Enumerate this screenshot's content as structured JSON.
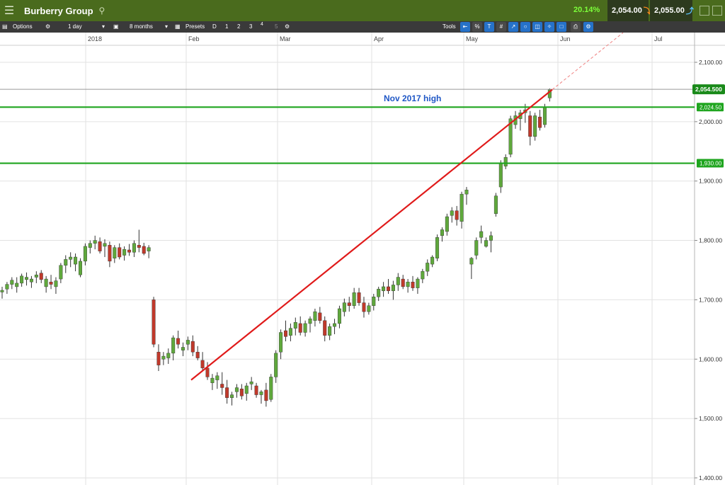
{
  "header": {
    "instrument": "Burberry Group",
    "change_pct": "20.14%",
    "sell_price": "2,054.00",
    "buy_price": "2,055.00"
  },
  "toolbar": {
    "options_label": "Options",
    "interval": "1 day",
    "range": "8 months",
    "presets_label": "Presets",
    "presets": [
      "D",
      "1",
      "2",
      "3",
      "4",
      "5"
    ],
    "tools_label": "Tools"
  },
  "colors": {
    "up": "#5fa83c",
    "down": "#c0392b",
    "trendline": "#e01a1a",
    "level": "#1fa51f",
    "label_blue": "#1f57c6"
  },
  "chart_data": {
    "type": "candlestick",
    "title": "",
    "x_tick_labels": [
      "2018",
      "Feb",
      "Mar",
      "Apr",
      "May",
      "Jun",
      "Jul"
    ],
    "y_tick_labels": [
      "2,100.00",
      "2,000.00",
      "1,900.00",
      "1,800.00",
      "1,700.00",
      "1,600.00",
      "1,500.00",
      "1,400.00"
    ],
    "ylim": [
      1380,
      2140
    ],
    "grid": true,
    "price_axis_side": "right",
    "annotations": [
      {
        "type": "text",
        "text": "Nov 2017 high"
      },
      {
        "type": "hline",
        "value": 2024.5,
        "label": "2,024.50",
        "color": "#1fa51f"
      },
      {
        "type": "hline",
        "value": 1930.0,
        "label": "1,930.00",
        "color": "#1fa51f"
      },
      {
        "type": "last_price",
        "value": 2054.5,
        "label": "2,054.500"
      },
      {
        "type": "trendline",
        "from": [
          1565,
          "Feb 1"
        ],
        "to": [
          2054,
          "May 31"
        ],
        "extended": true
      }
    ],
    "candles": [
      {
        "o": 1713,
        "h": 1722,
        "l": 1702,
        "c": 1716
      },
      {
        "o": 1718,
        "h": 1730,
        "l": 1710,
        "c": 1726
      },
      {
        "o": 1726,
        "h": 1738,
        "l": 1718,
        "c": 1733
      },
      {
        "o": 1722,
        "h": 1738,
        "l": 1712,
        "c": 1728
      },
      {
        "o": 1728,
        "h": 1744,
        "l": 1722,
        "c": 1740
      },
      {
        "o": 1734,
        "h": 1746,
        "l": 1724,
        "c": 1738
      },
      {
        "o": 1730,
        "h": 1740,
        "l": 1720,
        "c": 1735
      },
      {
        "o": 1738,
        "h": 1748,
        "l": 1728,
        "c": 1742
      },
      {
        "o": 1745,
        "h": 1750,
        "l": 1728,
        "c": 1734
      },
      {
        "o": 1722,
        "h": 1740,
        "l": 1712,
        "c": 1735
      },
      {
        "o": 1730,
        "h": 1742,
        "l": 1718,
        "c": 1726
      },
      {
        "o": 1722,
        "h": 1738,
        "l": 1710,
        "c": 1732
      },
      {
        "o": 1735,
        "h": 1762,
        "l": 1728,
        "c": 1758
      },
      {
        "o": 1758,
        "h": 1775,
        "l": 1745,
        "c": 1768
      },
      {
        "o": 1768,
        "h": 1780,
        "l": 1755,
        "c": 1772
      },
      {
        "o": 1760,
        "h": 1778,
        "l": 1748,
        "c": 1772
      },
      {
        "o": 1742,
        "h": 1770,
        "l": 1738,
        "c": 1765
      },
      {
        "o": 1765,
        "h": 1795,
        "l": 1758,
        "c": 1790
      },
      {
        "o": 1788,
        "h": 1800,
        "l": 1778,
        "c": 1795
      },
      {
        "o": 1795,
        "h": 1808,
        "l": 1785,
        "c": 1800
      },
      {
        "o": 1798,
        "h": 1805,
        "l": 1778,
        "c": 1782
      },
      {
        "o": 1790,
        "h": 1802,
        "l": 1772,
        "c": 1795
      },
      {
        "o": 1792,
        "h": 1798,
        "l": 1755,
        "c": 1765
      },
      {
        "o": 1770,
        "h": 1792,
        "l": 1762,
        "c": 1788
      },
      {
        "o": 1788,
        "h": 1795,
        "l": 1768,
        "c": 1772
      },
      {
        "o": 1775,
        "h": 1790,
        "l": 1766,
        "c": 1785
      },
      {
        "o": 1784,
        "h": 1794,
        "l": 1774,
        "c": 1780
      },
      {
        "o": 1780,
        "h": 1800,
        "l": 1772,
        "c": 1795
      },
      {
        "o": 1792,
        "h": 1818,
        "l": 1780,
        "c": 1788
      },
      {
        "o": 1790,
        "h": 1796,
        "l": 1775,
        "c": 1778
      },
      {
        "o": 1782,
        "h": 1792,
        "l": 1770,
        "c": 1788
      },
      {
        "o": 1700,
        "h": 1705,
        "l": 1620,
        "c": 1625
      },
      {
        "o": 1612,
        "h": 1625,
        "l": 1580,
        "c": 1590
      },
      {
        "o": 1600,
        "h": 1612,
        "l": 1590,
        "c": 1605
      },
      {
        "o": 1602,
        "h": 1618,
        "l": 1592,
        "c": 1610
      },
      {
        "o": 1610,
        "h": 1640,
        "l": 1598,
        "c": 1636
      },
      {
        "o": 1635,
        "h": 1648,
        "l": 1618,
        "c": 1625
      },
      {
        "o": 1615,
        "h": 1628,
        "l": 1605,
        "c": 1620
      },
      {
        "o": 1625,
        "h": 1638,
        "l": 1615,
        "c": 1632
      },
      {
        "o": 1630,
        "h": 1640,
        "l": 1605,
        "c": 1612
      },
      {
        "o": 1612,
        "h": 1622,
        "l": 1598,
        "c": 1602
      },
      {
        "o": 1598,
        "h": 1612,
        "l": 1580,
        "c": 1585
      },
      {
        "o": 1585,
        "h": 1595,
        "l": 1565,
        "c": 1570
      },
      {
        "o": 1560,
        "h": 1575,
        "l": 1548,
        "c": 1568
      },
      {
        "o": 1565,
        "h": 1578,
        "l": 1550,
        "c": 1572
      },
      {
        "o": 1558,
        "h": 1578,
        "l": 1540,
        "c": 1552
      },
      {
        "o": 1552,
        "h": 1565,
        "l": 1525,
        "c": 1535
      },
      {
        "o": 1535,
        "h": 1545,
        "l": 1522,
        "c": 1540
      },
      {
        "o": 1545,
        "h": 1558,
        "l": 1535,
        "c": 1552
      },
      {
        "o": 1550,
        "h": 1558,
        "l": 1532,
        "c": 1538
      },
      {
        "o": 1542,
        "h": 1560,
        "l": 1530,
        "c": 1555
      },
      {
        "o": 1558,
        "h": 1570,
        "l": 1548,
        "c": 1562
      },
      {
        "o": 1555,
        "h": 1560,
        "l": 1535,
        "c": 1540
      },
      {
        "o": 1540,
        "h": 1548,
        "l": 1525,
        "c": 1545
      },
      {
        "o": 1548,
        "h": 1560,
        "l": 1520,
        "c": 1530
      },
      {
        "o": 1532,
        "h": 1575,
        "l": 1528,
        "c": 1570
      },
      {
        "o": 1570,
        "h": 1615,
        "l": 1560,
        "c": 1610
      },
      {
        "o": 1612,
        "h": 1650,
        "l": 1600,
        "c": 1645
      },
      {
        "o": 1648,
        "h": 1665,
        "l": 1630,
        "c": 1638
      },
      {
        "o": 1640,
        "h": 1660,
        "l": 1630,
        "c": 1652
      },
      {
        "o": 1652,
        "h": 1670,
        "l": 1640,
        "c": 1662
      },
      {
        "o": 1660,
        "h": 1672,
        "l": 1640,
        "c": 1645
      },
      {
        "o": 1645,
        "h": 1665,
        "l": 1638,
        "c": 1660
      },
      {
        "o": 1660,
        "h": 1672,
        "l": 1645,
        "c": 1668
      },
      {
        "o": 1665,
        "h": 1685,
        "l": 1655,
        "c": 1680
      },
      {
        "o": 1678,
        "h": 1688,
        "l": 1660,
        "c": 1665
      },
      {
        "o": 1665,
        "h": 1672,
        "l": 1630,
        "c": 1640
      },
      {
        "o": 1640,
        "h": 1660,
        "l": 1632,
        "c": 1655
      },
      {
        "o": 1655,
        "h": 1668,
        "l": 1642,
        "c": 1660
      },
      {
        "o": 1660,
        "h": 1690,
        "l": 1652,
        "c": 1685
      },
      {
        "o": 1680,
        "h": 1702,
        "l": 1672,
        "c": 1695
      },
      {
        "o": 1695,
        "h": 1705,
        "l": 1680,
        "c": 1690
      },
      {
        "o": 1690,
        "h": 1720,
        "l": 1685,
        "c": 1712
      },
      {
        "o": 1712,
        "h": 1720,
        "l": 1690,
        "c": 1695
      },
      {
        "o": 1695,
        "h": 1705,
        "l": 1670,
        "c": 1680
      },
      {
        "o": 1680,
        "h": 1695,
        "l": 1675,
        "c": 1690
      },
      {
        "o": 1690,
        "h": 1710,
        "l": 1682,
        "c": 1705
      },
      {
        "o": 1705,
        "h": 1722,
        "l": 1698,
        "c": 1718
      },
      {
        "o": 1715,
        "h": 1730,
        "l": 1705,
        "c": 1722
      },
      {
        "o": 1722,
        "h": 1735,
        "l": 1710,
        "c": 1715
      },
      {
        "o": 1715,
        "h": 1732,
        "l": 1700,
        "c": 1725
      },
      {
        "o": 1725,
        "h": 1745,
        "l": 1715,
        "c": 1738
      },
      {
        "o": 1735,
        "h": 1742,
        "l": 1718,
        "c": 1722
      },
      {
        "o": 1722,
        "h": 1735,
        "l": 1712,
        "c": 1730
      },
      {
        "o": 1730,
        "h": 1740,
        "l": 1715,
        "c": 1720
      },
      {
        "o": 1720,
        "h": 1738,
        "l": 1710,
        "c": 1735
      },
      {
        "o": 1735,
        "h": 1752,
        "l": 1728,
        "c": 1748
      },
      {
        "o": 1748,
        "h": 1768,
        "l": 1740,
        "c": 1762
      },
      {
        "o": 1760,
        "h": 1775,
        "l": 1755,
        "c": 1772
      },
      {
        "o": 1770,
        "h": 1810,
        "l": 1765,
        "c": 1805
      },
      {
        "o": 1808,
        "h": 1822,
        "l": 1798,
        "c": 1818
      },
      {
        "o": 1815,
        "h": 1845,
        "l": 1808,
        "c": 1840
      },
      {
        "o": 1842,
        "h": 1856,
        "l": 1830,
        "c": 1850
      },
      {
        "o": 1850,
        "h": 1858,
        "l": 1825,
        "c": 1835
      },
      {
        "o": 1832,
        "h": 1882,
        "l": 1820,
        "c": 1878
      },
      {
        "o": 1878,
        "h": 1890,
        "l": 1860,
        "c": 1885
      },
      {
        "o": 1760,
        "h": 1772,
        "l": 1735,
        "c": 1770
      },
      {
        "o": 1775,
        "h": 1805,
        "l": 1768,
        "c": 1800
      },
      {
        "o": 1805,
        "h": 1825,
        "l": 1795,
        "c": 1815
      },
      {
        "o": 1790,
        "h": 1805,
        "l": 1788,
        "c": 1800
      },
      {
        "o": 1800,
        "h": 1815,
        "l": 1780,
        "c": 1808
      },
      {
        "o": 1845,
        "h": 1880,
        "l": 1840,
        "c": 1875
      },
      {
        "o": 1890,
        "h": 1935,
        "l": 1880,
        "c": 1930
      },
      {
        "o": 1925,
        "h": 1945,
        "l": 1920,
        "c": 1940
      },
      {
        "o": 1945,
        "h": 2010,
        "l": 1940,
        "c": 2005
      },
      {
        "o": 1995,
        "h": 2018,
        "l": 1988,
        "c": 2010
      },
      {
        "o": 2005,
        "h": 2020,
        "l": 1985,
        "c": 2015
      },
      {
        "o": 2015,
        "h": 2030,
        "l": 1998,
        "c": 2020
      },
      {
        "o": 2010,
        "h": 2018,
        "l": 1960,
        "c": 1975
      },
      {
        "o": 1975,
        "h": 2015,
        "l": 1968,
        "c": 2010
      },
      {
        "o": 2008,
        "h": 2020,
        "l": 1985,
        "c": 1990
      },
      {
        "o": 1995,
        "h": 2030,
        "l": 1990,
        "c": 2025
      },
      {
        "o": 2040,
        "h": 2056,
        "l": 2034,
        "c": 2054
      }
    ]
  }
}
